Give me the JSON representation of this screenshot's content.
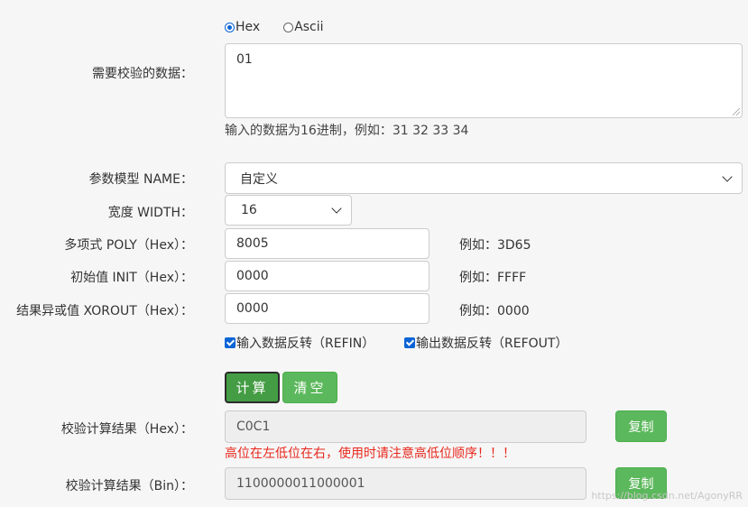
{
  "format": {
    "options": [
      {
        "label": "Hex",
        "checked": true
      },
      {
        "label": "Ascii",
        "checked": false
      }
    ]
  },
  "data_field": {
    "label": "需要校验的数据：",
    "value": "01",
    "help": "输入的数据为16进制，例如：31 32 33 34"
  },
  "model": {
    "label": "参数模型 NAME：",
    "value": "自定义"
  },
  "width": {
    "label": "宽度 WIDTH：",
    "value": "16"
  },
  "poly": {
    "label": "多项式 POLY（Hex）：",
    "value": "8005",
    "example": "例如：3D65"
  },
  "init": {
    "label": "初始值 INIT（Hex）：",
    "value": "0000",
    "example": "例如：FFFF"
  },
  "xorout": {
    "label": "结果异或值 XOROUT（Hex）：",
    "value": "0000",
    "example": "例如：0000"
  },
  "refin": {
    "label": "输入数据反转（REFIN）",
    "checked": true
  },
  "refout": {
    "label": "输出数据反转（REFOUT）",
    "checked": true
  },
  "buttons": {
    "calculate": "计算",
    "clear": "清空"
  },
  "result_hex": {
    "label": "校验计算结果（Hex）：",
    "value": "C0C1",
    "copy": "复制"
  },
  "warning": "高位在左低位在右，使用时请注意高低位顺序！！！",
  "result_bin": {
    "label": "校验计算结果（Bin）：",
    "value": "1100000011000001",
    "copy": "复制"
  },
  "watermark": "https://blog.csdn.net/AgonyRR",
  "colors": {
    "accent": "#0a64d6",
    "success": "#5cb85c",
    "warning": "#e8281d"
  }
}
